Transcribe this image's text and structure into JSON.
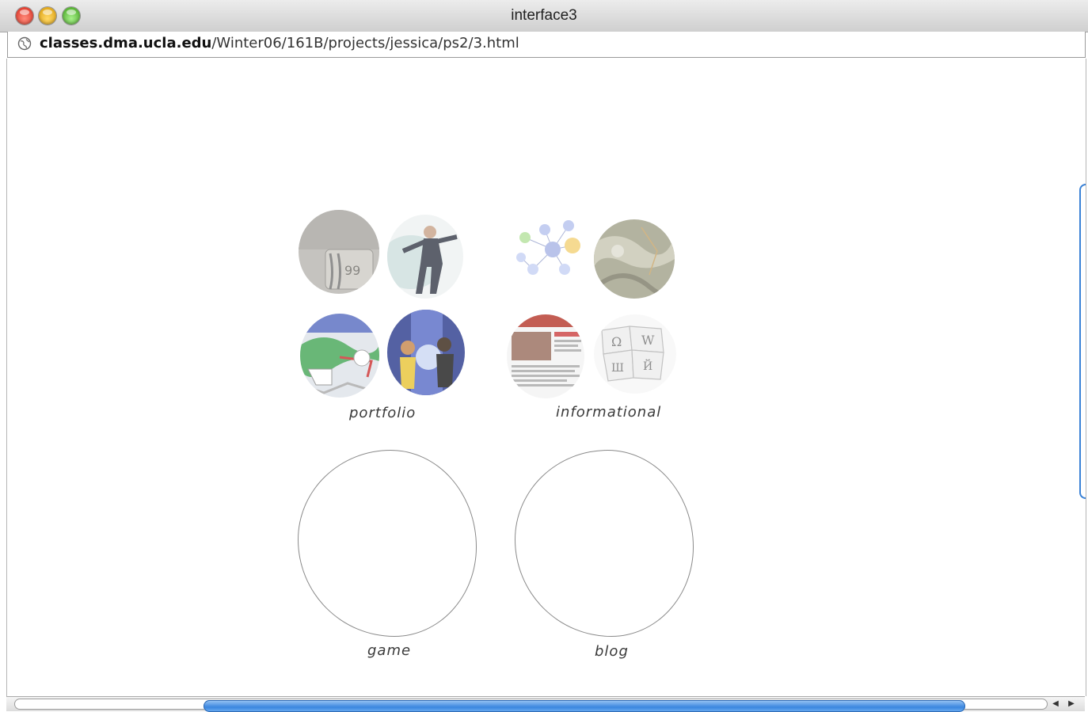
{
  "window": {
    "title": "interface3",
    "buttons": [
      "close",
      "minimize",
      "zoom"
    ]
  },
  "address_bar": {
    "host": "classes.dma.ucla.edu",
    "path": "/Winter06/161B/projects/jessica/ps2/3.html",
    "icon": "globe-icon"
  },
  "categories": [
    {
      "label": "portfolio",
      "thumbnails": [
        "concrete-sign-photo",
        "dancer-figure-photo",
        "colorful-map-illustration",
        "anime-characters-illustration"
      ]
    },
    {
      "label": "informational",
      "thumbnails": [
        "bubble-network-diagram",
        "satellite-terrain-map",
        "news-website-screenshot",
        "wikipedia-puzzle-globe"
      ]
    },
    {
      "label": "game",
      "thumbnails": []
    },
    {
      "label": "blog",
      "thumbnails": []
    }
  ],
  "scrollbar": {
    "left_arrow": "◀",
    "right_arrow": "▶"
  }
}
